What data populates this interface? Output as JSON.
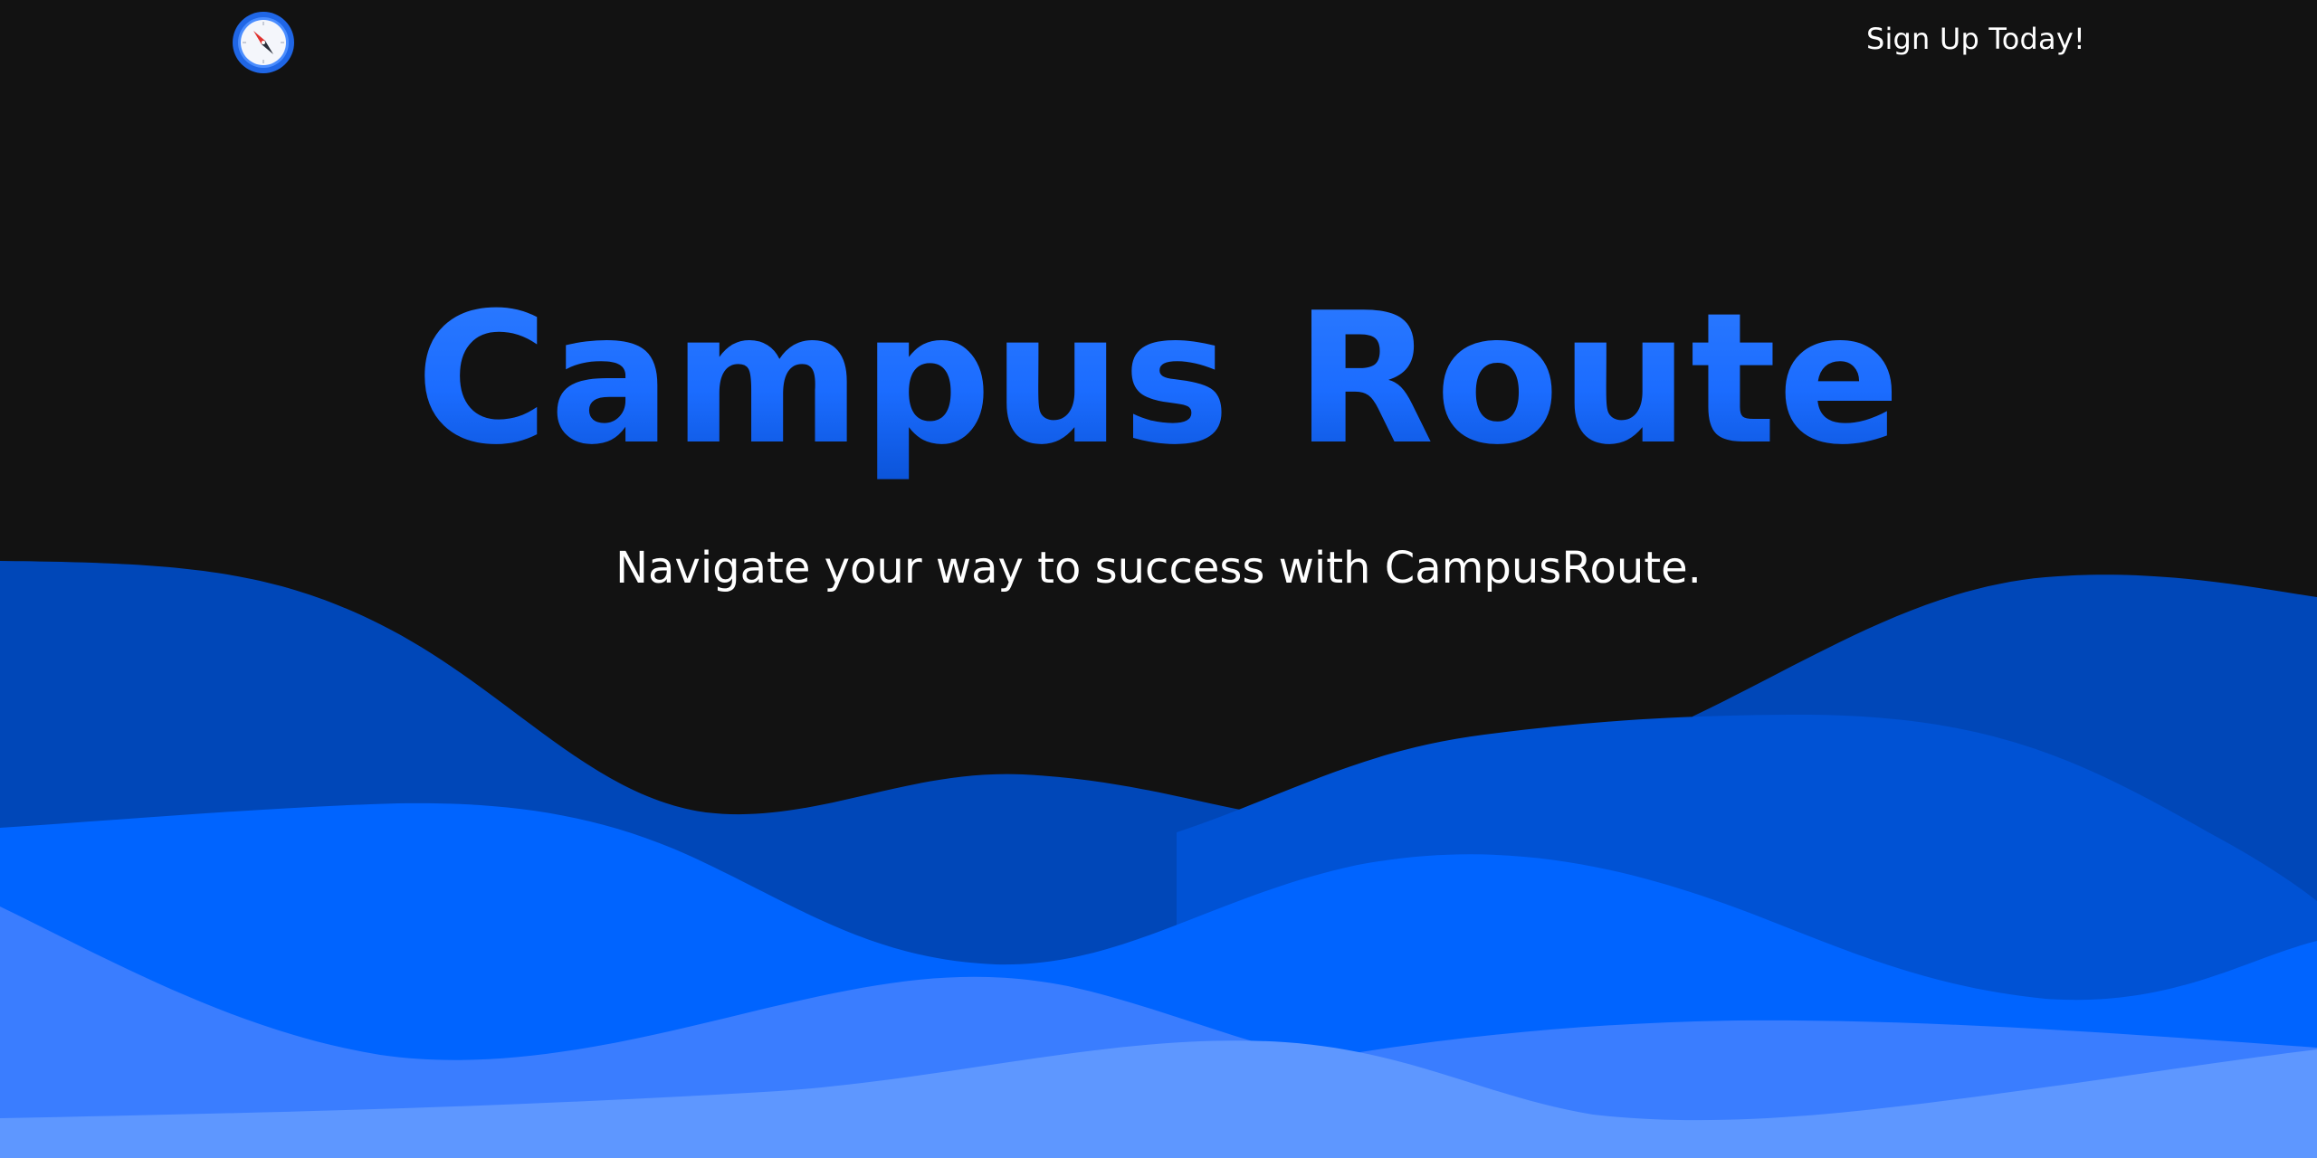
{
  "header": {
    "logo_icon": "compass-icon",
    "signup_label": "Sign Up Today!"
  },
  "hero": {
    "title": "Campus Route",
    "subtitle": "Navigate your way to success with CampusRoute."
  },
  "colors": {
    "background": "#121212",
    "title_gradient_top": "#2e7cff",
    "title_gradient_bottom": "#0a52d6",
    "wave_dark": "#0047b8",
    "wave_mid_dark": "#0052d4",
    "wave_bright": "#0064ff",
    "wave_light": "#3a7dff",
    "wave_lightest": "#5e97ff",
    "text": "#ffffff"
  }
}
